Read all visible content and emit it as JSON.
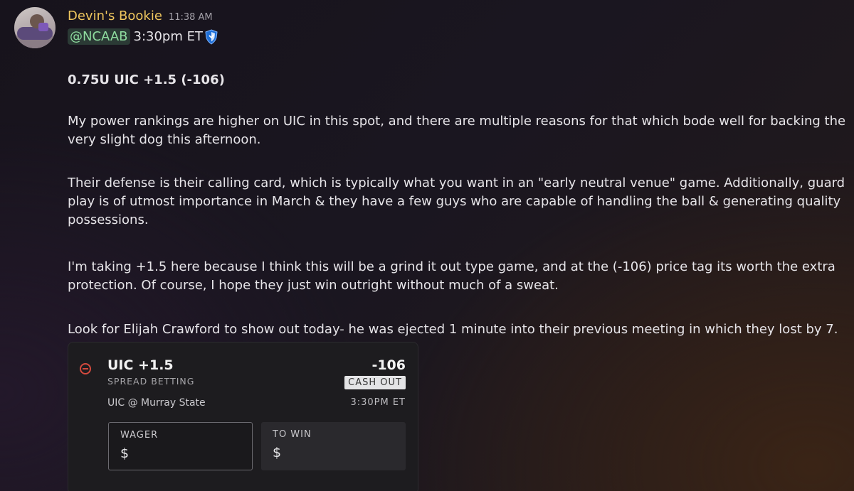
{
  "message": {
    "author": "Devin's Bookie",
    "timestamp": "11:38 AM",
    "mention": "@NCAAB",
    "game_time": "3:30pm ET",
    "shield_icon": "blue-shield-icon",
    "pick": "0.75U UIC +1.5 (-106)",
    "paragraphs": [
      "My power rankings are higher on UIC in this spot, and there are multiple reasons for that which bode well for backing the very slight dog this afternoon.",
      "Their defense is their calling card, which is typically what you want in an \"early neutral venue\" game. Additionally, guard play is of utmost importance in March & they have a few guys who are capable of handling the ball & generating quality possessions.",
      "I'm taking +1.5 here because I think this will be a grind it out type game, and at the (-106) price tag its worth the extra protection. Of course, I hope they just win outright without much of a sweat.",
      "Look for Elijah Crawford to show out today- he was ejected 1 minute into their previous meeting in which they lost by 7."
    ]
  },
  "bet_slip": {
    "selection": "UIC +1.5",
    "market": "SPREAD BETTING",
    "matchup": "UIC @ Murray State",
    "odds": "-106",
    "cash_out_label": "CASH OUT",
    "start_time": "3:30PM ET",
    "wager_label": "WAGER",
    "wager_currency": "$",
    "to_win_label": "TO WIN",
    "to_win_currency": "$"
  },
  "colors": {
    "author": "#f0c75e",
    "mention_text": "#8fdc9f",
    "remove_icon": "#d44a3e"
  }
}
